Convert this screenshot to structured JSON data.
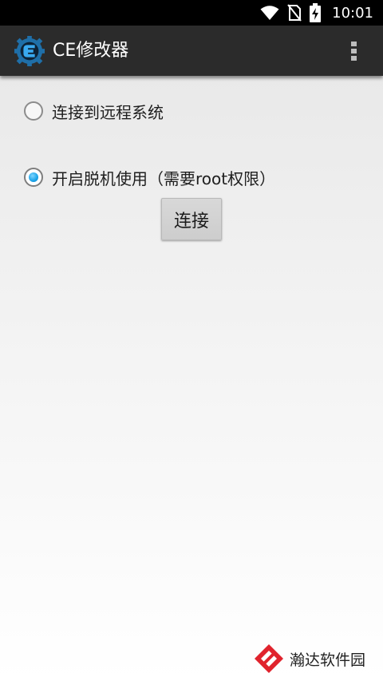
{
  "status_bar": {
    "time": "10:01",
    "icons": [
      "wifi-icon",
      "no-sim-icon",
      "battery-charging-icon"
    ]
  },
  "action_bar": {
    "title": "CE修改器",
    "logo_icon": "cheat-engine-logo",
    "overflow_icon": "more-vert-icon"
  },
  "options": [
    {
      "label": "连接到远程系统",
      "checked": false
    },
    {
      "label": "开启脱机使用（需要root权限）",
      "checked": true
    }
  ],
  "connect_button": {
    "label": "连接"
  },
  "watermark": {
    "text": "瀚达软件园"
  },
  "colors": {
    "status_bar": "#000000",
    "action_bar": "#2b2b2b",
    "radio_selected": "#1aa3e8",
    "watermark_red": "#e0232d"
  }
}
